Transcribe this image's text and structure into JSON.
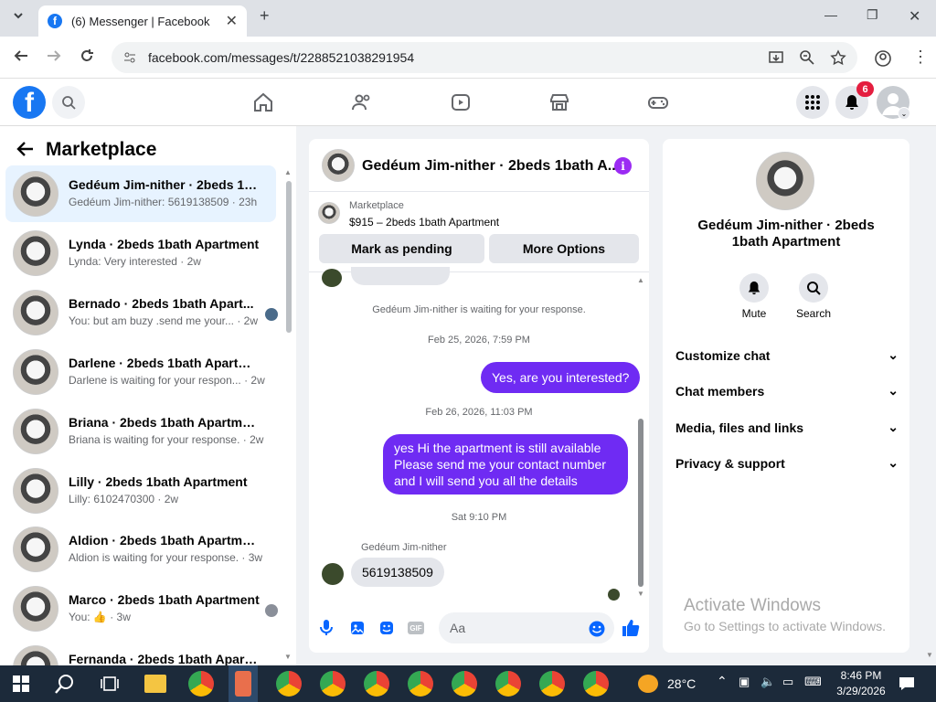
{
  "browser": {
    "tab_title": "(6) Messenger | Facebook",
    "url": "facebook.com/messages/t/2288521038291954"
  },
  "fb": {
    "logo_letter": "f",
    "notif_count": "6"
  },
  "left": {
    "title": "Marketplace",
    "conversations": [
      {
        "name": "Gedéum Jim-nither · 2beds 1bat...",
        "snippet": "Gedéum Jim-nither: 5619138509 · 23h"
      },
      {
        "name": "Lynda · 2beds 1bath Apartment",
        "snippet": "Lynda: Very interested · 2w"
      },
      {
        "name": "Bernado · 2beds 1bath Apart...",
        "snippet": "You: but am buzy .send me your... · 2w"
      },
      {
        "name": "Darlene · 2beds 1bath Apartment",
        "snippet": "Darlene is waiting for your respon... · 2w"
      },
      {
        "name": "Briana · 2beds 1bath Apartment",
        "snippet": "Briana is waiting for your response. · 2w"
      },
      {
        "name": "Lilly · 2beds 1bath Apartment",
        "snippet": "Lilly: 6102470300 · 2w"
      },
      {
        "name": "Aldion · 2beds 1bath Apartment",
        "snippet": "Aldion is waiting for your response. · 3w"
      },
      {
        "name": "Marco · 2beds 1bath Apartment",
        "snippet": "You: 👍 · 3w"
      },
      {
        "name": "Fernanda · 2beds 1bath Apartm...",
        "snippet": ""
      }
    ]
  },
  "chat": {
    "title": "Gedéum Jim-nither · 2beds 1bath A...",
    "marketplace_label": "Marketplace",
    "listing": "$915 – 2beds 1bath Apartment",
    "mark_pending": "Mark as pending",
    "more_options": "More Options",
    "waiting_msg": "Gedéum Jim-nither is waiting for your response.",
    "ts1": "Feb 25, 2026, 7:59 PM",
    "out1": "Yes, are you interested?",
    "ts2": "Feb 26, 2026, 11:03 PM",
    "out2_l1": "yes Hi the apartment is still available",
    "out2_l2": "Please send me your contact number",
    "out2_l3": "and I will send you all the details",
    "ts3": "Sat 9:10 PM",
    "sender": "Gedéum Jim-nither",
    "in1": "5619138509",
    "input_placeholder": "Aa"
  },
  "right": {
    "name": "Gedéum Jim-nither · 2beds 1bath Apartment",
    "mute": "Mute",
    "search": "Search",
    "sections": [
      "Customize chat",
      "Chat members",
      "Media, files and links",
      "Privacy & support"
    ]
  },
  "watermark": {
    "line1": "Activate Windows",
    "line2": "Go to Settings to activate Windows."
  },
  "taskbar": {
    "temp": "28°C",
    "time": "8:46 PM",
    "date": "3/29/2026"
  }
}
